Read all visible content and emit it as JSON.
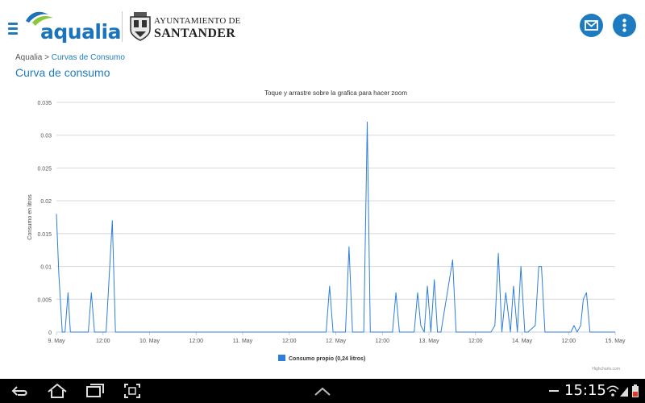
{
  "header": {
    "menu_icon": "hamburger-icon",
    "logo_text": "aqualia",
    "ayuntamiento_line1": "AYUNTAMIENTO DE",
    "ayuntamiento_line2": "SANTANDER",
    "mail_icon": "mail-icon",
    "more_icon": "more-vertical-icon",
    "accent_color": "#1f7bbf"
  },
  "breadcrumb": {
    "root": "Aqualia",
    "separator": " > ",
    "current": "Curvas de Consumo"
  },
  "page_title": "Curva de consumo",
  "chart_data": {
    "type": "line",
    "title": "Toque y arrastre sobre la grafica para hacer zoom",
    "ylabel": "Consumo en litros",
    "xlabel": "",
    "ylim": [
      0,
      0.035
    ],
    "xlim": [
      0,
      144
    ],
    "yticks": [
      0,
      0.005,
      0.01,
      0.015,
      0.02,
      0.025,
      0.03,
      0.035
    ],
    "ytick_labels": [
      "0",
      "0.005",
      "0.01",
      "0.015",
      "0.02",
      "0.025",
      "0.03",
      "0.035"
    ],
    "xtick_values": [
      0,
      12,
      24,
      36,
      48,
      60,
      72,
      84,
      96,
      108,
      120,
      132,
      144
    ],
    "xtick_labels": [
      "9. May",
      "12:00",
      "10. May",
      "12:00",
      "11. May",
      "12:00",
      "12. May",
      "12:00",
      "13. May",
      "12:00",
      "14. May",
      "12:00",
      "15. May"
    ],
    "grid": true,
    "legend_position": "bottom-center",
    "credits": "Highcharts.com",
    "series": [
      {
        "name": "Consumo propio (0,24 litros)",
        "color": "#2f7ed8",
        "x": [
          0,
          0.6,
          1.5,
          2.2,
          3,
          3.6,
          4.4,
          8.2,
          9,
          9.8,
          12.8,
          14.4,
          15.2,
          16,
          69.5,
          70.4,
          71.3,
          74.5,
          75.4,
          76.3,
          79.2,
          80.1,
          80.9,
          86.6,
          87.5,
          88.4,
          92.2,
          93.1,
          93.9,
          94.8,
          95.6,
          96.5,
          97.4,
          98.2,
          99.1,
          102.1,
          103,
          103.9,
          112,
          113,
          113.9,
          114.8,
          115.8,
          117,
          117.8,
          118.8,
          119.7,
          120.7,
          121.5,
          123.4,
          124.3,
          125,
          125.9,
          126.8,
          132.6,
          133.4,
          134.2,
          135.1,
          135.8,
          136.6,
          137.5,
          144
        ],
        "y": [
          0.018,
          0.009,
          0,
          0,
          0.006,
          0,
          0,
          0,
          0.006,
          0,
          0,
          0.017,
          0,
          0,
          0,
          0.007,
          0,
          0,
          0.013,
          0,
          0,
          0.032,
          0,
          0,
          0.006,
          0,
          0,
          0.006,
          0.001,
          0,
          0.007,
          0,
          0.008,
          0,
          0,
          0.011,
          0,
          0,
          0,
          0.001,
          0.012,
          0,
          0.006,
          0,
          0.007,
          0,
          0.01,
          0,
          0,
          0.001,
          0.01,
          0.01,
          0,
          0,
          0,
          0.001,
          0,
          0.001,
          0.005,
          0.006,
          0,
          0
        ]
      }
    ]
  },
  "navbar": {
    "back_icon": "back-icon",
    "home_icon": "home-icon",
    "recents_icon": "recent-apps-icon",
    "screenshot_icon": "screenshot-icon",
    "up_icon": "chevron-up-icon",
    "time": "15:15",
    "wifi_icon": "wifi-icon",
    "signal_icon": "signal-icon",
    "battery_icon": "battery-icon"
  }
}
